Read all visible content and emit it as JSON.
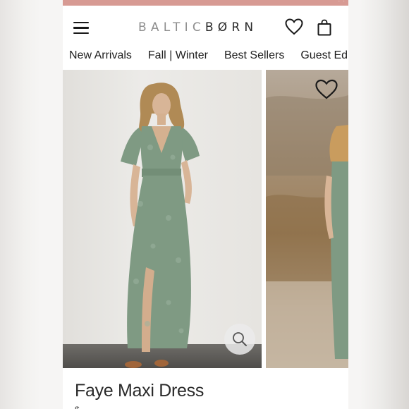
{
  "header": {
    "logo_primary": "BALTIC",
    "logo_secondary": "BØRN",
    "promo_dots": "· ·"
  },
  "nav": {
    "items": [
      {
        "label": "New Arrivals"
      },
      {
        "label": "Fall | Winter"
      },
      {
        "label": "Best Sellers"
      },
      {
        "label": "Guest Edit"
      }
    ]
  },
  "product": {
    "title": "Faye Maxi Dress",
    "price_peek": "$"
  },
  "colors": {
    "promo_bar": "#d79a93",
    "dress": "#7f9a83",
    "text": "#1e1e1e"
  },
  "icons": [
    "menu-icon",
    "heart-icon",
    "bag-icon",
    "search-icon",
    "wishlist-heart-icon"
  ]
}
